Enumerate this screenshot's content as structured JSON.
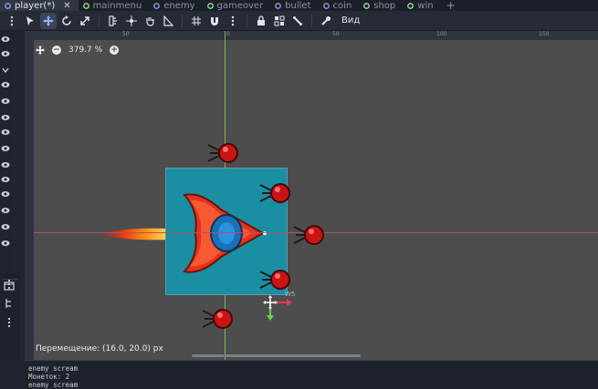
{
  "tabs": [
    {
      "label": "player(*)",
      "active": true,
      "icon": "node2d-icon"
    },
    {
      "label": "mainmenu",
      "active": false,
      "icon": "control-icon"
    },
    {
      "label": "enemy",
      "active": false,
      "icon": "node2d-icon"
    },
    {
      "label": "gameover",
      "active": false,
      "icon": "control-icon"
    },
    {
      "label": "bullet",
      "active": false,
      "icon": "node2d-icon"
    },
    {
      "label": "coin",
      "active": false,
      "icon": "node2d-icon"
    },
    {
      "label": "shop",
      "active": false,
      "icon": "control-icon"
    },
    {
      "label": "win",
      "active": false,
      "icon": "control-icon"
    }
  ],
  "toolbar": {
    "view_label": "Вид"
  },
  "ruler": {
    "marks": [
      "50",
      "0",
      "50",
      "100",
      "150"
    ]
  },
  "viewport": {
    "zoom": "379.7 %",
    "status": "Перемещение: (16.0, 20.0) px",
    "gizmo_label": "W5"
  },
  "console": {
    "lines": [
      "enemy scream",
      "Монеток: 2",
      "enemy scream"
    ]
  },
  "colors": {
    "viewport_bg": "#4d4d4d",
    "sprite_bg": "#1a8ea3",
    "axis_x": "#b05070",
    "axis_y": "#7fb35a",
    "accent": "#3b4458"
  }
}
